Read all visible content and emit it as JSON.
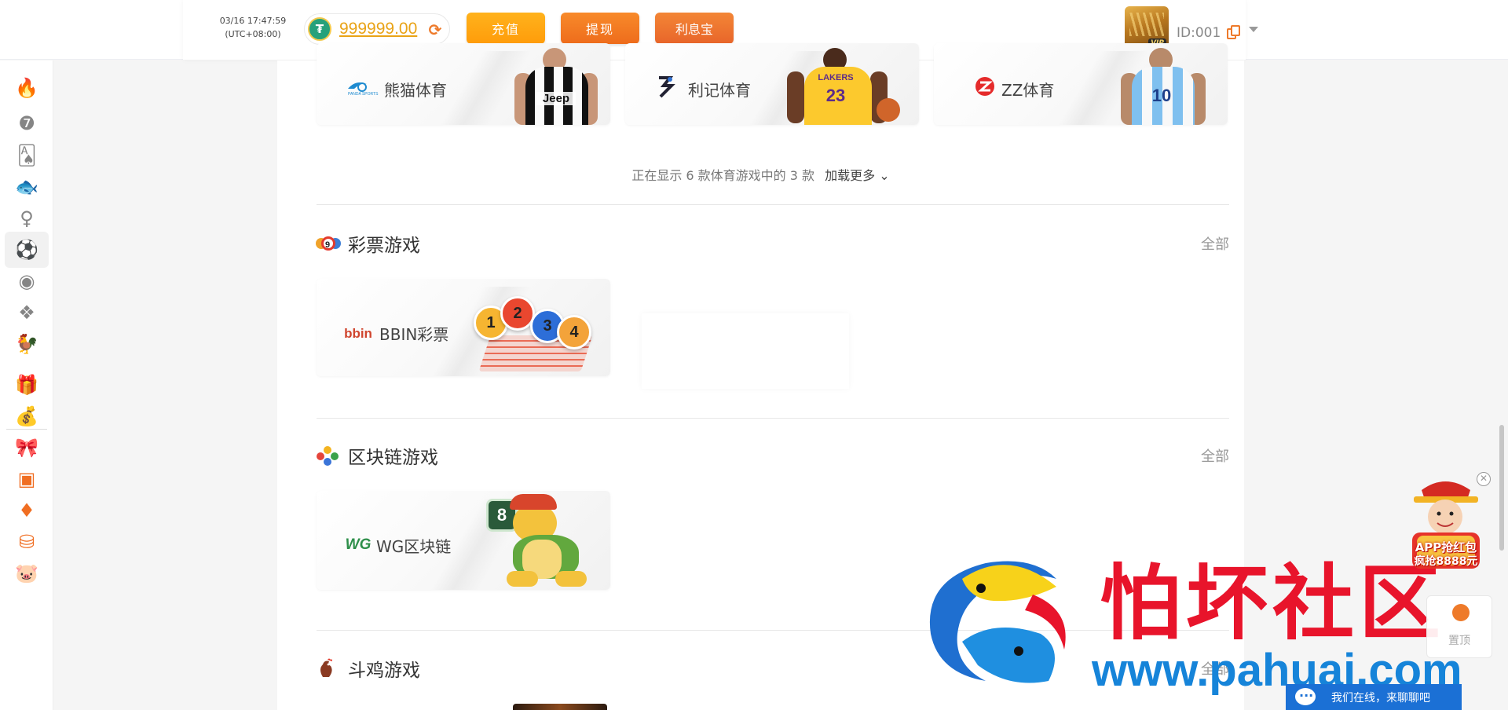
{
  "header": {
    "date": "03/16 17:47:59",
    "timezone": "(UTC+08:00)",
    "balance": "999999.00",
    "currency_icon": "usdt-icon",
    "buttons": {
      "recharge": "充值",
      "withdraw": "提现",
      "interest": "利息宝"
    },
    "vip_badge": "VIP",
    "user_id": "ID:001"
  },
  "sidebar": {
    "items": [
      {
        "icon": "hot-icon",
        "glyph": "🔥"
      },
      {
        "icon": "slot-777-icon",
        "glyph": "❼"
      },
      {
        "icon": "cards-icon",
        "glyph": "🂡"
      },
      {
        "icon": "fish-icon",
        "glyph": "🐟"
      },
      {
        "icon": "live-dealer-icon",
        "glyph": "♀"
      },
      {
        "icon": "sports-ball-icon",
        "glyph": "⚽"
      },
      {
        "icon": "lottery-icon",
        "glyph": "◉"
      },
      {
        "icon": "blockchain-icon",
        "glyph": "❖"
      },
      {
        "icon": "rooster-icon",
        "glyph": "🐓"
      },
      {
        "icon": "gift-box-icon",
        "glyph": "🎁"
      },
      {
        "icon": "money-bag-icon",
        "glyph": "💰"
      },
      {
        "icon": "present-icon",
        "glyph": "🎀"
      },
      {
        "icon": "promo-box-icon",
        "glyph": "▣"
      },
      {
        "icon": "vip-shield-icon",
        "glyph": "♦"
      },
      {
        "icon": "coins-icon",
        "glyph": "⛁"
      },
      {
        "icon": "piggy-bank-icon",
        "glyph": "🐷"
      }
    ]
  },
  "sports": {
    "cards": [
      {
        "name": "熊猫体育",
        "logo_sub": "PANDA SPORTS"
      },
      {
        "name": "利记体育"
      },
      {
        "name": "ZZ体育"
      }
    ],
    "load_status": "正在显示 6 款体育游戏中的 3 款",
    "load_more": "加载更多"
  },
  "lottery": {
    "title": "彩票游戏",
    "see_all": "全部",
    "card": {
      "name": "BBIN彩票",
      "logo": "bbin"
    },
    "ball_numbers": [
      "1",
      "2",
      "3",
      "4"
    ],
    "title_icon_number": "9"
  },
  "blockchain": {
    "title": "区块链游戏",
    "see_all": "全部",
    "card": {
      "name": "WG区块链",
      "logo": "WG"
    },
    "badge_number": "8"
  },
  "cockfight": {
    "title": "斗鸡游戏",
    "see_all": "全部"
  },
  "players": [
    {
      "number": "",
      "shirt": "striped"
    },
    {
      "number": "23",
      "shirt": "LAKERS"
    },
    {
      "number": "10",
      "shirt": "striped-blue"
    }
  ],
  "watermark": {
    "text": "怕坏社区",
    "url": "www.pahuai.com"
  },
  "floating": {
    "promo_line1": "APP抢红包",
    "promo_line2": "疯抢8888元",
    "top_button": "置顶",
    "chat": "我们在线，来聊聊吧"
  },
  "colors": {
    "accent_orange": "#ee7a2a",
    "balance_gold": "#e9a316",
    "watermark_red": "#e8142b",
    "watermark_blue": "#1684d9",
    "chat_blue": "#1b70d5"
  }
}
